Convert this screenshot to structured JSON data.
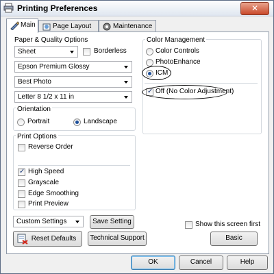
{
  "window": {
    "title": "Printing Preferences",
    "close_glyph": "✕"
  },
  "tabs": [
    {
      "label": "Main",
      "icon": "main-tab-icon"
    },
    {
      "label": "Page Layout",
      "icon": "page-layout-icon"
    },
    {
      "label": "Maintenance",
      "icon": "maintenance-icon"
    }
  ],
  "paper_quality": {
    "group_label": "Paper & Quality Options",
    "source": "Sheet",
    "borderless_label": "Borderless",
    "borderless_checked": false,
    "media_type": "Epson Premium Glossy",
    "quality": "Best Photo",
    "paper_size": "Letter 8 1/2 x 11 in"
  },
  "orientation": {
    "group_label": "Orientation",
    "portrait": "Portrait",
    "landscape": "Landscape",
    "selected": "Landscape"
  },
  "print_options": {
    "group_label": "Print Options",
    "reverse_order": "Reverse Order",
    "high_speed": "High Speed",
    "grayscale": "Grayscale",
    "edge_smoothing": "Edge Smoothing",
    "print_preview": "Print Preview"
  },
  "color_management": {
    "group_label": "Color Management",
    "color_controls": "Color Controls",
    "photoenhance": "PhotoEnhance",
    "icm": "ICM",
    "selected": "ICM",
    "off_label": "Off (No Color Adjustment)",
    "off_checked": true
  },
  "custom": {
    "settings_value": "Custom Settings",
    "save_setting": "Save Setting",
    "show_screen_first": "Show this screen first",
    "reset_defaults": "Reset Defaults",
    "technical_support": "Technical Support",
    "basic": "Basic"
  },
  "footer": {
    "ok": "OK",
    "cancel": "Cancel",
    "help": "Help"
  }
}
